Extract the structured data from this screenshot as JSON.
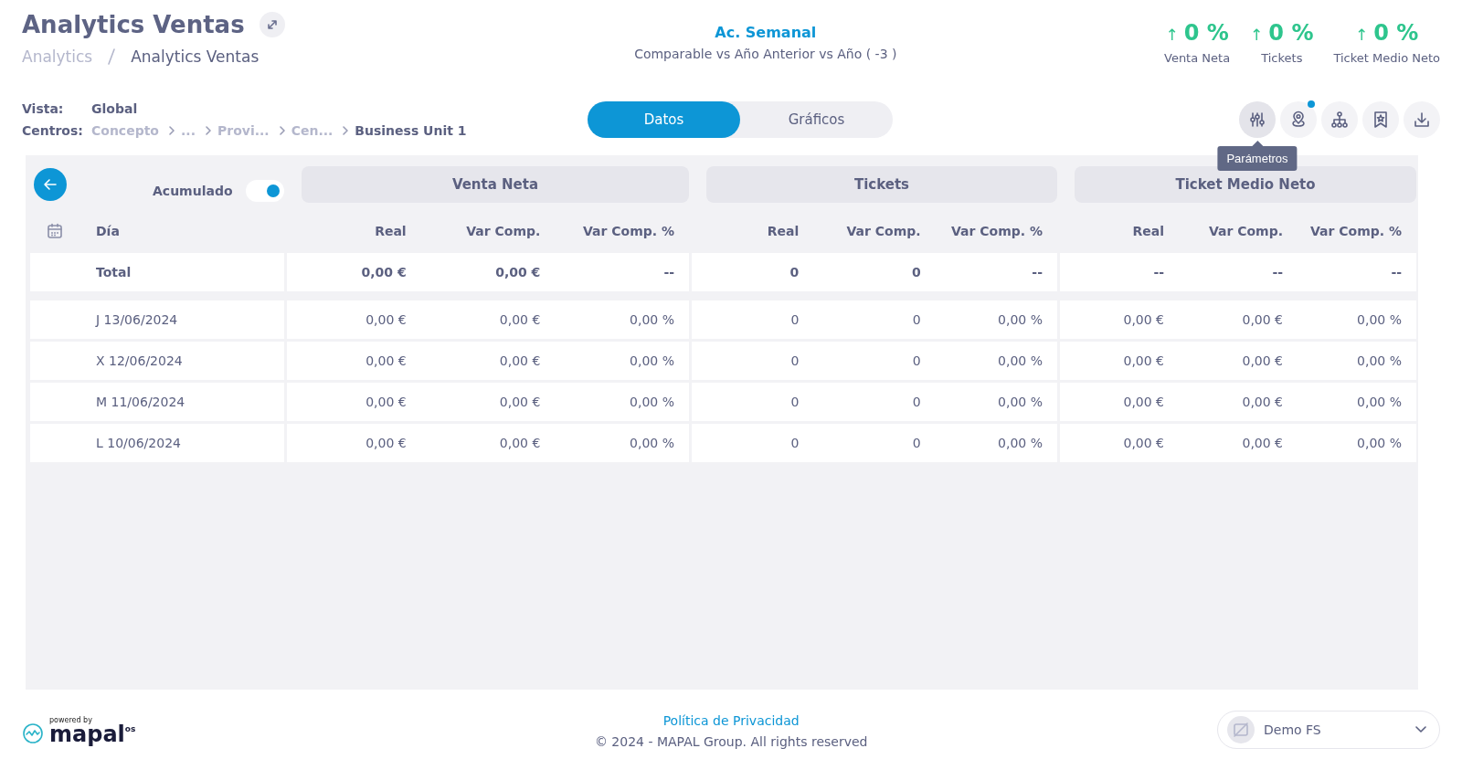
{
  "header": {
    "title": "Analytics Ventas",
    "breadcrumb": [
      "Analytics",
      "Analytics Ventas"
    ]
  },
  "period": {
    "title": "Ac. Semanal",
    "subtitle": "Comparable vs Año Anterior vs Año ( -3 )"
  },
  "kpis": [
    {
      "arrow": "↑",
      "value": "0 %",
      "label": "Venta Neta"
    },
    {
      "arrow": "↑",
      "value": "0 %",
      "label": "Tickets"
    },
    {
      "arrow": "↑",
      "value": "0 %",
      "label": "Ticket Medio Neto"
    }
  ],
  "filters": {
    "vista_label": "Vista:",
    "vista_value": "Global",
    "centros_label": "Centros:",
    "centros_path": [
      "Concepto",
      "...",
      "Provi...",
      "Cen...",
      "Business Unit 1"
    ]
  },
  "view_toggle": [
    {
      "label": "Datos",
      "selected": true
    },
    {
      "label": "Gráficos",
      "selected": false
    }
  ],
  "toolbar": [
    {
      "kind": "sliders",
      "hovered": true,
      "badge": false
    },
    {
      "kind": "pin",
      "hovered": false,
      "badge": true
    },
    {
      "kind": "hierarchy",
      "hovered": false,
      "badge": false
    },
    {
      "kind": "bookmark",
      "hovered": false,
      "badge": false
    },
    {
      "kind": "download",
      "hovered": false,
      "badge": false
    }
  ],
  "tooltip": "Parámetros",
  "table": {
    "accumulated": {
      "label": "Acumulado",
      "on": true
    },
    "day_header": "Día",
    "groups": [
      {
        "title": "Venta Neta",
        "columns": [
          "Real",
          "Var Comp.",
          "Var Comp. %"
        ]
      },
      {
        "title": "Tickets",
        "columns": [
          "Real",
          "Var Comp.",
          "Var Comp. %"
        ]
      },
      {
        "title": "Ticket Medio Neto",
        "columns": [
          "Real",
          "Var Comp.",
          "Var Comp. %"
        ]
      }
    ],
    "total": {
      "label": "Total",
      "cells": [
        "0,00 €",
        "0,00 €",
        "--",
        "0",
        "0",
        "--",
        "--",
        "--",
        "--"
      ]
    },
    "rows": [
      {
        "day": "J 13/06/2024",
        "cells": [
          "0,00 €",
          "0,00 €",
          "0,00 %",
          "0",
          "0",
          "0,00 %",
          "0,00 €",
          "0,00 €",
          "0,00 %"
        ]
      },
      {
        "day": "X 12/06/2024",
        "cells": [
          "0,00 €",
          "0,00 €",
          "0,00 %",
          "0",
          "0",
          "0,00 %",
          "0,00 €",
          "0,00 €",
          "0,00 %"
        ]
      },
      {
        "day": "M 11/06/2024",
        "cells": [
          "0,00 €",
          "0,00 €",
          "0,00 %",
          "0",
          "0",
          "0,00 %",
          "0,00 €",
          "0,00 €",
          "0,00 %"
        ]
      },
      {
        "day": "L 10/06/2024",
        "cells": [
          "0,00 €",
          "0,00 €",
          "0,00 %",
          "0",
          "0",
          "0,00 %",
          "0,00 €",
          "0,00 €",
          "0,00 %"
        ]
      }
    ]
  },
  "footer": {
    "powered_by": "powered by",
    "logo": "mapal",
    "logo_suffix": "os",
    "privacy": "Política de Privacidad",
    "copyright": "© 2024 - MAPAL Group. All rights reserved",
    "user": "Demo FS"
  }
}
